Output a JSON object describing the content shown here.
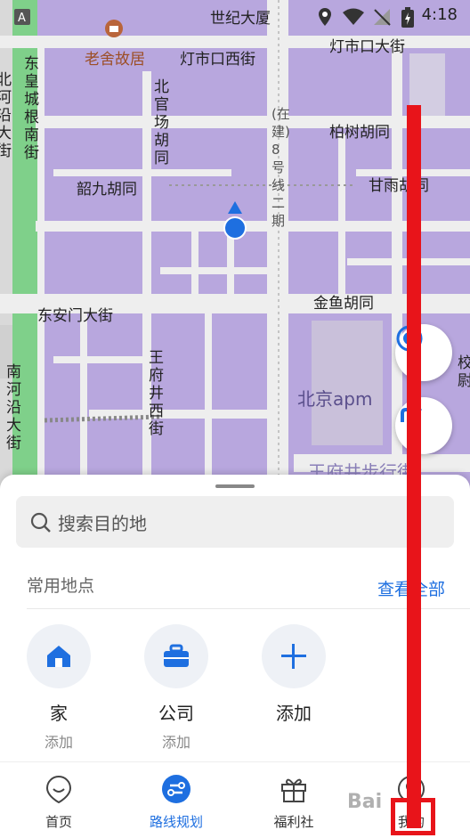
{
  "status_bar": {
    "title": "世纪大厦",
    "time": "4:18"
  },
  "map": {
    "labels": {
      "laoshe": "老舍故居",
      "dengshikou_xijie": "灯市口西街",
      "dengshikou_dajie": "灯市口大街",
      "dongcheng_nanjie": "东皇城根南街",
      "beiheyan": "北河沿大街",
      "beiguanchang": "北官场胡同",
      "line8": "(在建)8号线二期",
      "baishu": "柏树胡同",
      "shaojiu": "韶九胡同",
      "ganyu": "甘雨胡同",
      "donganmen": "东安门大街",
      "jinyu": "金鱼胡同",
      "wangfujing_xijie": "王府井西街",
      "nanheyan": "南河沿大街",
      "apm": "北京apm",
      "walkstreet": "王府井步行街",
      "right_edge": "校尉"
    }
  },
  "sheet": {
    "search_placeholder": "搜索目的地",
    "section_title": "常用地点",
    "view_all": "查看全部",
    "places": [
      {
        "name": "家",
        "sub": "添加",
        "icon": "home-icon"
      },
      {
        "name": "公司",
        "sub": "添加",
        "icon": "briefcase-icon"
      },
      {
        "name": "添加",
        "sub": "",
        "icon": "plus-icon"
      }
    ]
  },
  "tabs": [
    {
      "label": "首页",
      "icon": "map-pin-icon",
      "active": false
    },
    {
      "label": "路线规划",
      "icon": "route-icon",
      "active": true
    },
    {
      "label": "福利社",
      "icon": "gift-icon",
      "active": false
    },
    {
      "label": "我的",
      "icon": "user-icon",
      "active": false
    }
  ],
  "watermark": "Bai",
  "colors": {
    "accent": "#1e6fe0",
    "map_block": "#b8a7de",
    "road": "#eeeeee",
    "annotation": "#e8141a"
  }
}
